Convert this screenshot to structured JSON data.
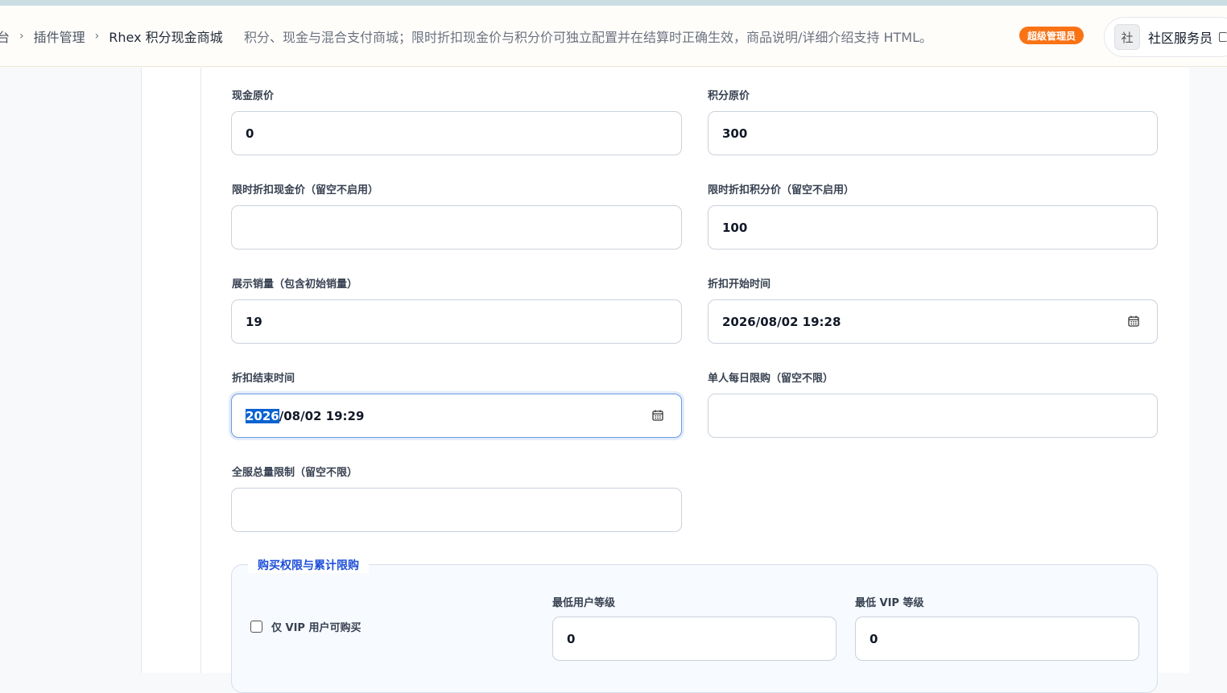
{
  "breadcrumb": {
    "items": [
      "台",
      "插件管理",
      "Rhex 积分现金商城"
    ]
  },
  "header": {
    "description": "积分、现金与混合支付商城；限时折扣现金价与积分价可独立配置并在结算时正确生效，商品说明/详细介绍支持 HTML。",
    "role_badge": "超级管理员",
    "user_avatar": "社",
    "user_name": "社区服务员"
  },
  "form": {
    "cash_price": {
      "label": "现金原价",
      "value": "0"
    },
    "points_price": {
      "label": "积分原价",
      "value": "300"
    },
    "discount_cash_price": {
      "label": "限时折扣现金价（留空不启用）",
      "value": ""
    },
    "discount_points_price": {
      "label": "限时折扣积分价（留空不启用）",
      "value": "100"
    },
    "display_sales": {
      "label": "展示销量（包含初始销量）",
      "value": "19"
    },
    "discount_start": {
      "label": "折扣开始时间",
      "value": "2026/08/02 19:28"
    },
    "discount_end": {
      "label": "折扣结束时间",
      "value_selected": "2026",
      "value_rest": "/08/02 19:29"
    },
    "daily_limit": {
      "label": "单人每日限购（留空不限）",
      "value": ""
    },
    "global_limit": {
      "label": "全服总量限制（留空不限）",
      "value": ""
    }
  },
  "purchase_section": {
    "legend": "购买权限与累计限购",
    "vip_only_label": "仅 VIP 用户可购买",
    "min_user_level": {
      "label": "最低用户等级",
      "value": "0"
    },
    "min_vip_level": {
      "label": "最低 VIP 等级",
      "value": "0"
    }
  },
  "icons": {
    "calendar": "calendar-icon",
    "chevron": "chevron-right-icon"
  },
  "colors": {
    "accent": "#1d4ed8",
    "badge": "#f97316",
    "selection": "#0b63d1"
  }
}
